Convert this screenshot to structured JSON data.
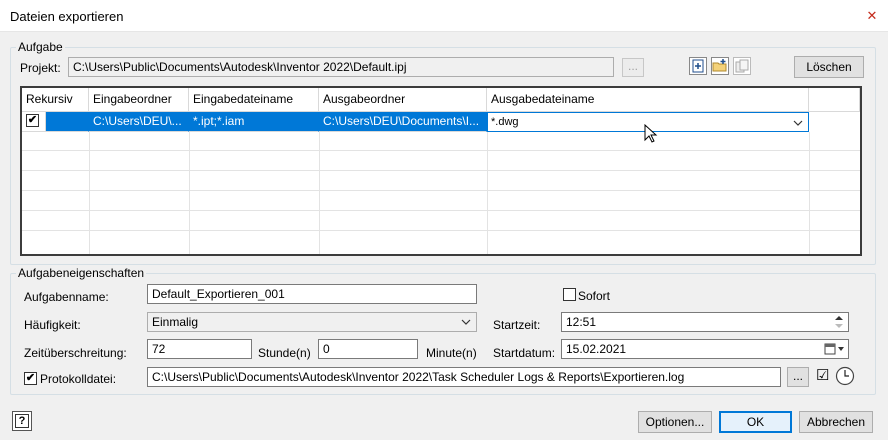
{
  "window": {
    "title": "Dateien exportieren",
    "close_glyph": "✕"
  },
  "task_group": {
    "label": "Aufgabe",
    "project_label": "Projekt:",
    "project_value": "C:\\Users\\Public\\Documents\\Autodesk\\Inventor 2022\\Default.ipj",
    "browse_label": "...",
    "delete_label": "Löschen"
  },
  "grid": {
    "columns": [
      "Rekursiv",
      "Eingabeordner",
      "Eingabedateiname",
      "Ausgabeordner",
      "Ausgabedateiname"
    ],
    "rows": [
      {
        "recursive_mark": "✔",
        "input_folder": "C:\\Users\\DEU\\...",
        "input_filename": "*.ipt;*.iam",
        "output_folder": "C:\\Users\\DEU\\Documents\\I...",
        "output_filename": "*.dwg"
      }
    ]
  },
  "props_group": {
    "label": "Aufgabeneigenschaften",
    "task_name_label": "Aufgabenname:",
    "task_name_value": "Default_Exportieren_001",
    "immediate_label": "Sofort",
    "frequency_label": "Häufigkeit:",
    "frequency_value": "Einmalig",
    "start_time_label": "Startzeit:",
    "start_time_value": "12:51",
    "timeout_label": "Zeitüberschreitung:",
    "timeout_hours_value": "72",
    "hours_label": "Stunde(n)",
    "timeout_minutes_value": "0",
    "minutes_label": "Minute(n)",
    "start_date_label": "Startdatum:",
    "start_date_value": "15.02.2021",
    "logfile_label": "Protokolldatei:",
    "logfile_check_mark": "✔",
    "logfile_value": "C:\\Users\\Public\\Documents\\Autodesk\\Inventor 2022\\Task Scheduler Logs & Reports\\Exportieren.log",
    "logfile_browse_label": "...",
    "logfile_opt_mark": "☑"
  },
  "footer": {
    "help_glyph": "?",
    "options_label": "Optionen...",
    "ok_label": "OK",
    "cancel_label": "Abbrechen"
  },
  "colors": {
    "selection": "#0078d7",
    "close": "#c42b1c"
  }
}
